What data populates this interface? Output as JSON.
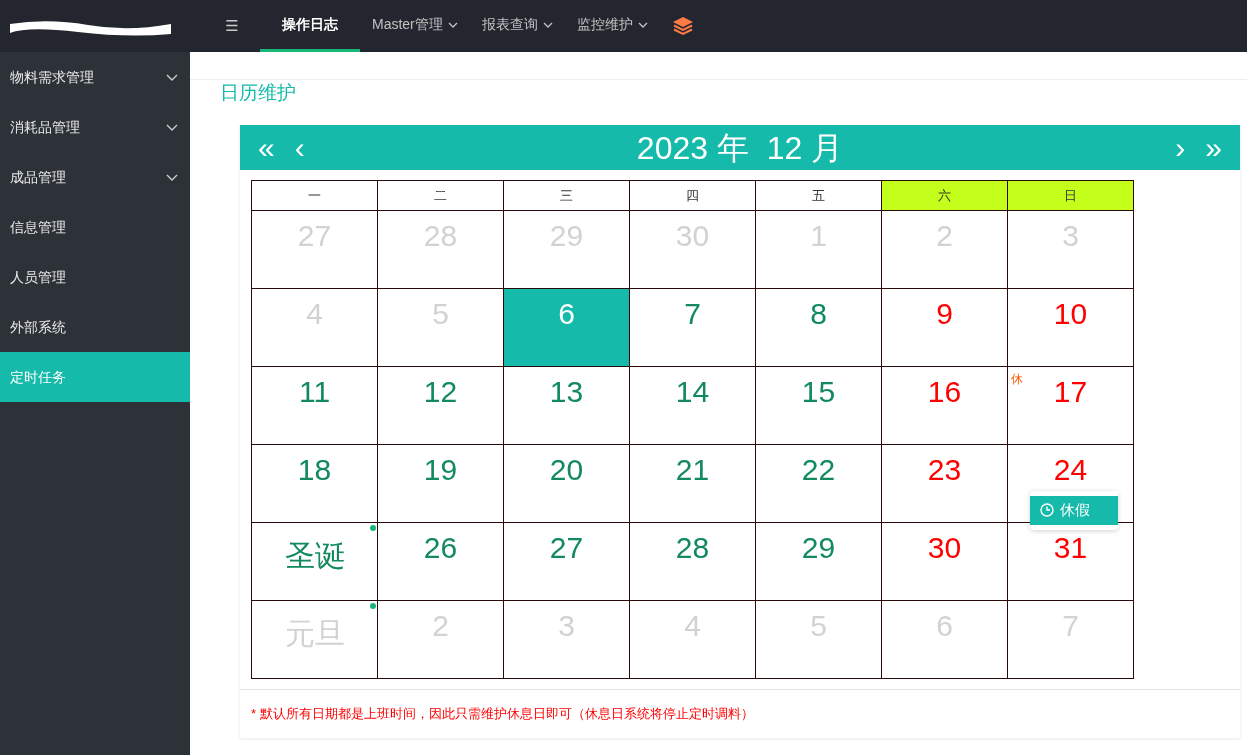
{
  "topbar": {
    "menu_toggle": "☰",
    "tabs": [
      {
        "label": "操作日志",
        "selected": true,
        "dropdown": false
      },
      {
        "label": "Master管理",
        "selected": false,
        "dropdown": true
      },
      {
        "label": "报表查询",
        "selected": false,
        "dropdown": true
      },
      {
        "label": "监控维护",
        "selected": false,
        "dropdown": true
      }
    ]
  },
  "sidebar": {
    "items": [
      {
        "label": "物料需求管理",
        "expandable": true,
        "selected": false
      },
      {
        "label": "消耗品管理",
        "expandable": true,
        "selected": false
      },
      {
        "label": "成品管理",
        "expandable": true,
        "selected": false
      },
      {
        "label": "信息管理",
        "expandable": false,
        "selected": false
      },
      {
        "label": "人员管理",
        "expandable": false,
        "selected": false
      },
      {
        "label": "外部系统",
        "expandable": false,
        "selected": false
      },
      {
        "label": "定时任务",
        "expandable": false,
        "selected": true
      }
    ]
  },
  "page_title": "日历维护",
  "calendar": {
    "prev_year": "«",
    "prev_month": "‹",
    "title": "2023 年  12 月",
    "next_month": "›",
    "next_year": "»",
    "weekdays": [
      {
        "label": "一",
        "weekend": false
      },
      {
        "label": "二",
        "weekend": false
      },
      {
        "label": "三",
        "weekend": false
      },
      {
        "label": "四",
        "weekend": false
      },
      {
        "label": "五",
        "weekend": false
      },
      {
        "label": "六",
        "weekend": true
      },
      {
        "label": "日",
        "weekend": true
      }
    ],
    "weeks": [
      [
        {
          "label": "27",
          "kind": "other",
          "selected": false
        },
        {
          "label": "28",
          "kind": "other",
          "selected": false
        },
        {
          "label": "29",
          "kind": "other",
          "selected": false
        },
        {
          "label": "30",
          "kind": "other",
          "selected": false
        },
        {
          "label": "1",
          "kind": "other",
          "selected": false
        },
        {
          "label": "2",
          "kind": "other",
          "selected": false
        },
        {
          "label": "3",
          "kind": "other",
          "selected": false
        }
      ],
      [
        {
          "label": "4",
          "kind": "other",
          "selected": false
        },
        {
          "label": "5",
          "kind": "other",
          "selected": false
        },
        {
          "label": "6",
          "kind": "work",
          "selected": true
        },
        {
          "label": "7",
          "kind": "work",
          "selected": false
        },
        {
          "label": "8",
          "kind": "work",
          "selected": false
        },
        {
          "label": "9",
          "kind": "rest",
          "selected": false
        },
        {
          "label": "10",
          "kind": "rest",
          "selected": false
        }
      ],
      [
        {
          "label": "11",
          "kind": "work",
          "selected": false
        },
        {
          "label": "12",
          "kind": "work",
          "selected": false
        },
        {
          "label": "13",
          "kind": "work",
          "selected": false
        },
        {
          "label": "14",
          "kind": "work",
          "selected": false
        },
        {
          "label": "15",
          "kind": "work",
          "selected": false
        },
        {
          "label": "16",
          "kind": "rest",
          "selected": false
        },
        {
          "label": "17",
          "kind": "rest",
          "selected": false,
          "tag": "休"
        }
      ],
      [
        {
          "label": "18",
          "kind": "work",
          "selected": false
        },
        {
          "label": "19",
          "kind": "work",
          "selected": false
        },
        {
          "label": "20",
          "kind": "work",
          "selected": false
        },
        {
          "label": "21",
          "kind": "work",
          "selected": false
        },
        {
          "label": "22",
          "kind": "work",
          "selected": false
        },
        {
          "label": "23",
          "kind": "rest",
          "selected": false
        },
        {
          "label": "24",
          "kind": "rest",
          "selected": false,
          "menu": {
            "label": "休假"
          }
        }
      ],
      [
        {
          "label": "圣诞",
          "kind": "work",
          "selected": false,
          "festival": true
        },
        {
          "label": "26",
          "kind": "work",
          "selected": false
        },
        {
          "label": "27",
          "kind": "work",
          "selected": false
        },
        {
          "label": "28",
          "kind": "work",
          "selected": false
        },
        {
          "label": "29",
          "kind": "work",
          "selected": false
        },
        {
          "label": "30",
          "kind": "rest",
          "selected": false
        },
        {
          "label": "31",
          "kind": "rest",
          "selected": false
        }
      ],
      [
        {
          "label": "元旦",
          "kind": "other",
          "selected": false,
          "festival": true
        },
        {
          "label": "2",
          "kind": "other",
          "selected": false
        },
        {
          "label": "3",
          "kind": "other",
          "selected": false
        },
        {
          "label": "4",
          "kind": "other",
          "selected": false
        },
        {
          "label": "5",
          "kind": "other",
          "selected": false
        },
        {
          "label": "6",
          "kind": "other",
          "selected": false
        },
        {
          "label": "7",
          "kind": "other",
          "selected": false
        }
      ]
    ]
  },
  "note": "* 默认所有日期都是上班时间，因此只需维护休息日即可（休息日系统将停止定时调料）"
}
